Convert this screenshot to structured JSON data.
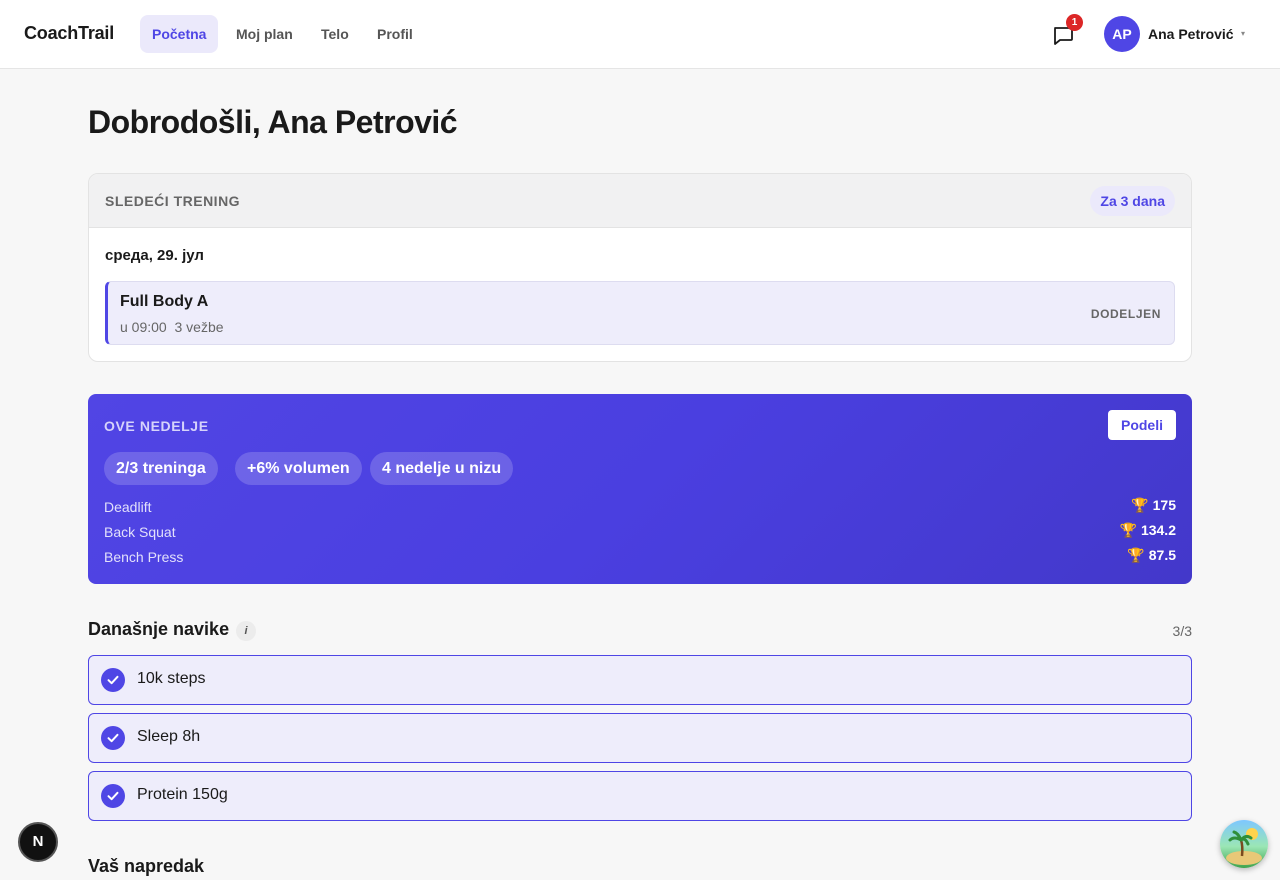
{
  "header": {
    "brand": "CoachTrail",
    "nav": [
      {
        "label": "Početna",
        "active": true
      },
      {
        "label": "Moj plan",
        "active": false
      },
      {
        "label": "Telo",
        "active": false
      },
      {
        "label": "Profil",
        "active": false
      }
    ],
    "messages_badge": "1",
    "messages_icon": "chat-bubble-icon",
    "user": {
      "initials": "AP",
      "name": "Ana Petrović",
      "caret": "▾"
    }
  },
  "page_title": "Dobrodošli, Ana Petrović",
  "next_training": {
    "label": "SLEDEĆI TRENING",
    "badge": "Za 3 dana",
    "date": "среда, 29. јул",
    "workout": {
      "name": "Full Body A",
      "meta": "u 09:00  3 vežbe",
      "status": "DODELJEN"
    }
  },
  "week": {
    "label": "OVE NEDELJE",
    "share": "Podeli",
    "stats": [
      "2/3 treninga",
      "+6% volumen",
      "4 nedelje u nizu"
    ],
    "records": [
      {
        "name": "Deadlift",
        "value": "175"
      },
      {
        "name": "Back Squat",
        "value": "134.2"
      },
      {
        "name": "Bench Press",
        "value": "87.5"
      }
    ],
    "trophy": "🏆"
  },
  "habits": {
    "title": "Današnje navike",
    "info": "i",
    "count": "3/3",
    "items": [
      {
        "label": "10k steps",
        "done": true
      },
      {
        "label": "Sleep 8h",
        "done": true
      },
      {
        "label": "Protein 150g",
        "done": true
      }
    ]
  },
  "progress_title": "Vaš napredak",
  "colors": {
    "accent": "#4f46e5",
    "badge": "#dc2626"
  },
  "fab": {
    "next": "N"
  }
}
